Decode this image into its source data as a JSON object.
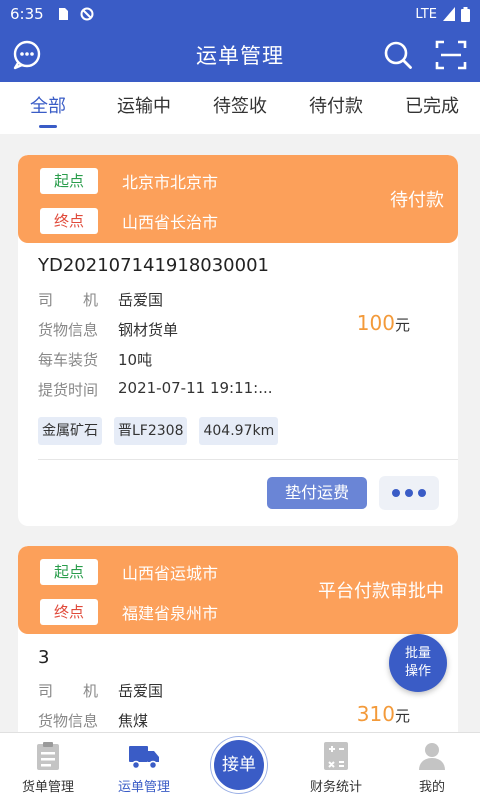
{
  "status_bar": {
    "time": "6:35",
    "network": "LTE"
  },
  "app_bar": {
    "title": "运单管理",
    "left_icon": "chat-bubble-icon",
    "search_icon": "search-icon",
    "scan_icon": "scan-icon"
  },
  "tabs": [
    {
      "label": "全部",
      "active": true
    },
    {
      "label": "运输中"
    },
    {
      "label": "待签收"
    },
    {
      "label": "待付款"
    },
    {
      "label": "已完成"
    }
  ],
  "orders": [
    {
      "start_tag": "起点",
      "start": "北京市北京市",
      "end_tag": "终点",
      "end": "山西省长治市",
      "status": "待付款",
      "order_no": "YD202107141918030001",
      "driver_label": "司　　机",
      "driver": "岳爱国",
      "goods_label": "货物信息",
      "goods": "钢材货单",
      "load_label": "每车装货",
      "load": "10吨",
      "pickup_label": "提货时间",
      "pickup": "2021-07-11 19:11:...",
      "price": "100",
      "unit": "元",
      "chips": [
        "金属矿石",
        "晋LF2308",
        "404.97km"
      ],
      "pay_label": "垫付运费"
    },
    {
      "start_tag": "起点",
      "start": "山西省运城市",
      "end_tag": "终点",
      "end": "福建省泉州市",
      "status": "平台付款审批中",
      "order_no": "3",
      "driver_label": "司　　机",
      "driver": "岳爱国",
      "goods_label": "货物信息",
      "goods": "焦煤",
      "price": "310",
      "unit": "元"
    }
  ],
  "batch_button": {
    "line1": "批量",
    "line2": "操作"
  },
  "bottom_nav": [
    {
      "label": "货单管理",
      "icon": "clipboard-icon"
    },
    {
      "label": "运单管理",
      "icon": "truck-icon",
      "active": true
    },
    {
      "label": "接单",
      "icon": "accept-order-button"
    },
    {
      "label": "财务统计",
      "icon": "calculator-icon"
    },
    {
      "label": "我的",
      "icon": "user-icon"
    }
  ],
  "colors": {
    "primary": "#3a5cc6",
    "orange": "#fca05a",
    "price": "#f39a3a",
    "start_green": "#2a9d4b",
    "end_red": "#e04a3a"
  }
}
